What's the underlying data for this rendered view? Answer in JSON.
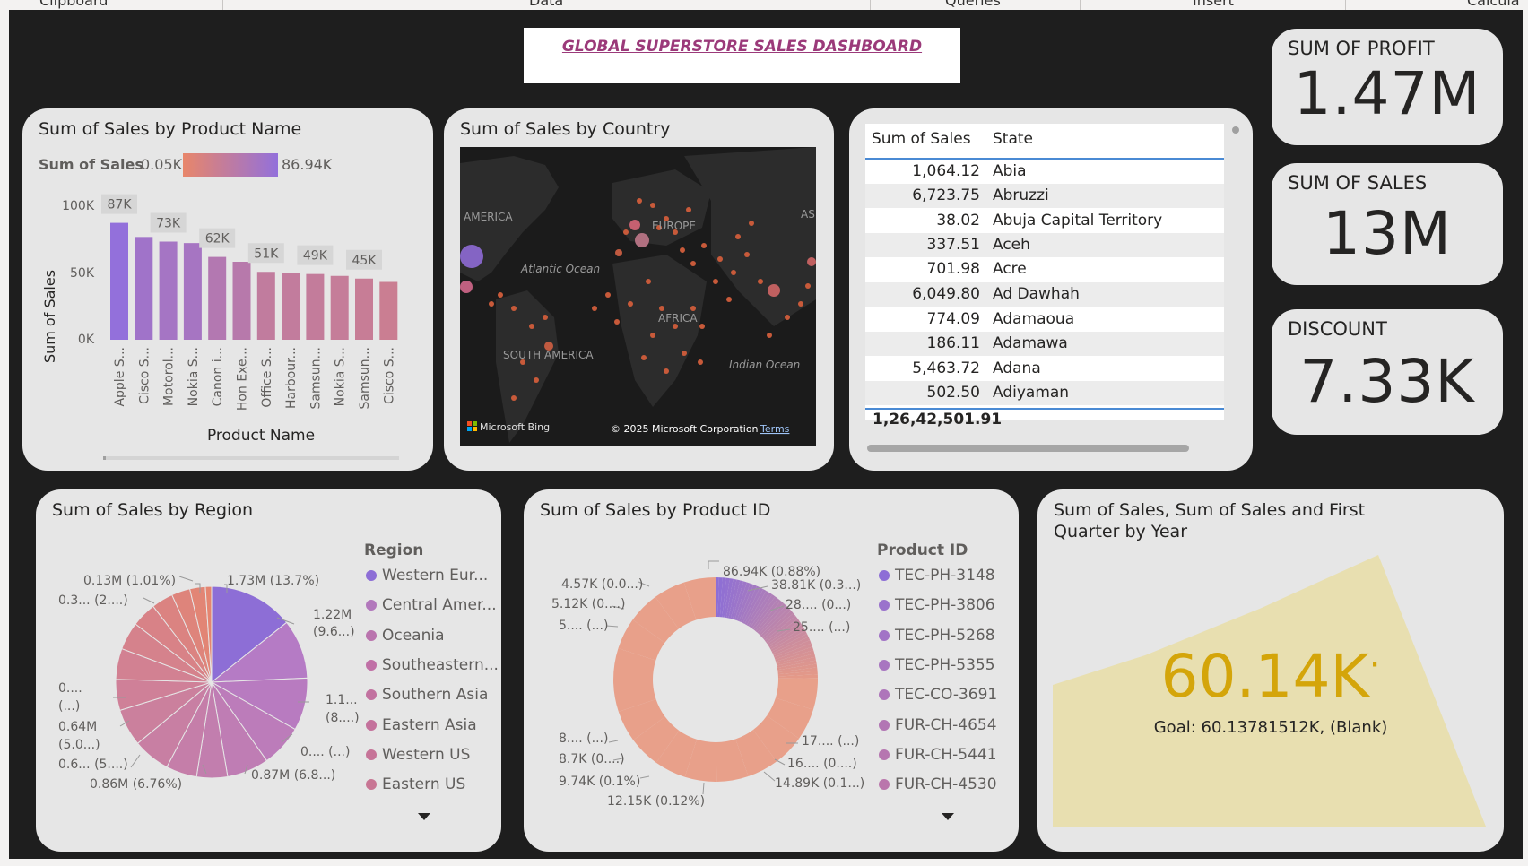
{
  "ribbon": {
    "groups": [
      "Clipboard",
      "Data",
      "Queries",
      "Insert",
      "Calcula"
    ]
  },
  "report_title": "GLOBAL SUPERSTORE SALES DASHBOARD",
  "kpis": {
    "profit": {
      "label": "SUM OF PROFIT",
      "value": "1.47M"
    },
    "sales": {
      "label": "SUM OF SALES",
      "value": "13M"
    },
    "discount": {
      "label": "DISCOUNT",
      "value": "7.33K"
    }
  },
  "product_chart": {
    "title": "Sum of Sales by Product Name",
    "legend_label": "Sum of Sales",
    "legend_min": "0.05K",
    "legend_max": "86.94K",
    "ylabel": "Sum of Sales",
    "xlabel": "Product Name",
    "yticks": [
      "100K",
      "50K",
      "0K"
    ]
  },
  "map": {
    "title": "Sum of Sales by Country",
    "labels": {
      "america": "AMERICA",
      "europe": "EUROPE",
      "asia": "AS",
      "atlantic": "Atlantic Ocean",
      "africa": "AFRICA",
      "south_america": "SOUTH AMERICA",
      "indian": "Indian Ocean"
    },
    "bing": "Microsoft Bing",
    "copyright": "© 2025 Microsoft Corporation",
    "terms": "Terms"
  },
  "state_table": {
    "col_sales": "Sum of Sales",
    "col_state": "State",
    "rows": [
      {
        "sales": "1,064.12",
        "state": "Abia"
      },
      {
        "sales": "6,723.75",
        "state": "Abruzzi"
      },
      {
        "sales": "38.02",
        "state": "Abuja Capital Territory"
      },
      {
        "sales": "337.51",
        "state": "Aceh"
      },
      {
        "sales": "701.98",
        "state": "Acre"
      },
      {
        "sales": "6,049.80",
        "state": "Ad Dawhah"
      },
      {
        "sales": "774.09",
        "state": "Adamaoua"
      },
      {
        "sales": "186.11",
        "state": "Adamawa"
      },
      {
        "sales": "5,463.72",
        "state": "Adana"
      },
      {
        "sales": "502.50",
        "state": "Adiyaman"
      }
    ],
    "total": "1,26,42,501.91"
  },
  "region_chart": {
    "title": "Sum of Sales by Region",
    "legend_title": "Region",
    "legend": [
      "Western Eur...",
      "Central Amer...",
      "Oceania",
      "Southeastern...",
      "Southern Asia",
      "Eastern Asia",
      "Western US",
      "Eastern US"
    ],
    "labels": {
      "l1": "1.73M (13.7%)",
      "l2a": "1.22M",
      "l2b": "(9.6...)",
      "l3a": "1.1...",
      "l3b": "(8....)",
      "l4": "0.... (...)",
      "l5": "0.87M (6.8...)",
      "l6": "0.86M (6.76%)",
      "l7": "0.6... (5....)",
      "l8a": "0.64M",
      "l8b": "(5.0...)",
      "l9a": "0....",
      "l9b": "(...)",
      "l10": "0.3... (2....)",
      "l11": "0.13M (1.01%)"
    }
  },
  "productid_chart": {
    "title": "Sum of Sales by Product ID",
    "legend_title": "Product ID",
    "legend": [
      "TEC-PH-3148",
      "TEC-PH-3806",
      "TEC-PH-5268",
      "TEC-PH-5355",
      "TEC-CO-3691",
      "FUR-CH-4654",
      "FUR-CH-5441",
      "FUR-CH-4530"
    ],
    "labels": {
      "a": "86.94K (0.88%)",
      "b": "38.81K (0.3...)",
      "c": "28.... (0...)",
      "d": "25.... (...)",
      "e": "17.... (...)",
      "f": "16.... (0....)",
      "g": "14.89K (0.1...)",
      "h": "12.15K (0.12%)",
      "i": "9.74K (0.1%)",
      "j": "8.7K (0....)",
      "k": "8.... (...)",
      "l": "5.... (...)",
      "m": "5.12K (0....)",
      "n": "4.57K (0.0...)"
    }
  },
  "gauge": {
    "title_line1": "Sum of Sales, Sum of Sales and First",
    "title_line2": "Quarter by Year",
    "value": "60.14K",
    "goal": "Goal: 60.13781512K, (Blank)"
  },
  "chart_data": {
    "type": "bar",
    "title": "Sum of Sales by Product Name",
    "xlabel": "Product Name",
    "ylabel": "Sum of Sales",
    "ylim": [
      0,
      100000
    ],
    "categories": [
      "Apple S...",
      "Cisco S...",
      "Motorol...",
      "Nokia S...",
      "Canon i...",
      "Hon Exe...",
      "Office S...",
      "Harbour...",
      "Samsun...",
      "Nokia S...",
      "Samsun...",
      "Cisco S..."
    ],
    "values": [
      86940,
      76440,
      73000,
      71900,
      61600,
      58000,
      50500,
      49800,
      48900,
      47500,
      45500,
      43000
    ],
    "data_labels": {
      "0": "87K",
      "2": "73K",
      "4": "62K",
      "6": "51K",
      "8": "49K",
      "10": "45K"
    },
    "colors": {
      "high": "#9370db",
      "low": "#e8866a"
    }
  }
}
